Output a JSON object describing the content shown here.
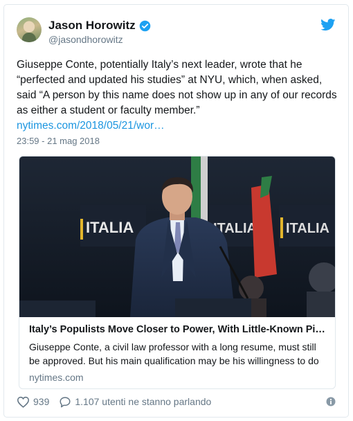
{
  "author": {
    "name": "Jason Horowitz",
    "handle": "@jasondhorowitz"
  },
  "tweet": {
    "text": "Giuseppe Conte, potentially Italy’s next leader, wrote that he “perfected and updated his studies” at NYU, which, when asked, said “A person by this name does not show up in any of our records as either a student or faculty member.”",
    "link": "nytimes.com/2018/05/21/wor…",
    "timestamp": "23:59 - 21 mag 2018"
  },
  "card": {
    "photo_sign": "ITALIA",
    "title": "Italy’s Populists Move Closer to Power, With Little-Known Pi…",
    "description": "Giuseppe Conte, a civil law professor with a long resume, must still be approved. But his main qualification may be his willingness to do",
    "domain": "nytimes.com"
  },
  "footer": {
    "likes": "939",
    "conversation": "1.107 utenti ne stanno parlando"
  },
  "colors": {
    "link": "#1b95e0",
    "muted": "#657786",
    "border": "#e1e8ed",
    "twitter_blue": "#1da1f2"
  },
  "icons": [
    "verified-badge-icon",
    "twitter-bird-icon",
    "heart-icon",
    "speech-bubble-icon",
    "info-icon"
  ]
}
